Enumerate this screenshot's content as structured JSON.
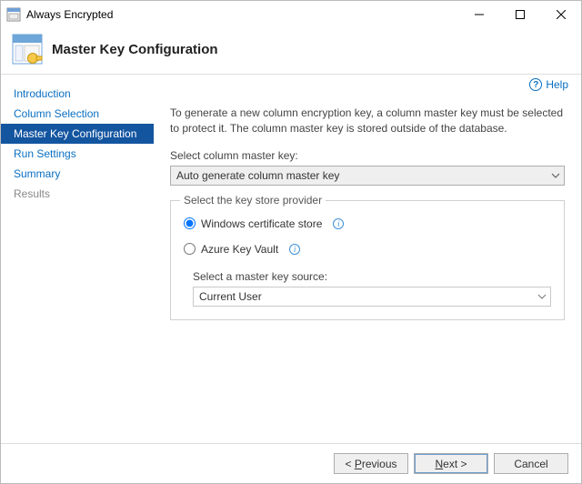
{
  "window": {
    "title": "Always Encrypted"
  },
  "header": {
    "title": "Master Key Configuration"
  },
  "sidebar": {
    "items": [
      {
        "label": "Introduction",
        "state": "link"
      },
      {
        "label": "Column Selection",
        "state": "link"
      },
      {
        "label": "Master Key Configuration",
        "state": "active"
      },
      {
        "label": "Run Settings",
        "state": "link"
      },
      {
        "label": "Summary",
        "state": "link"
      },
      {
        "label": "Results",
        "state": "disabled"
      }
    ]
  },
  "main": {
    "help_label": "Help",
    "intro_text": "To generate a new column encryption key, a column master key must be selected to protect it.  The column master key is stored outside of the database.",
    "select_cmk_label": "Select column master key:",
    "select_cmk_value": "Auto generate column master key",
    "fieldset_legend": "Select the key store provider",
    "radio_windows_label": "Windows certificate store",
    "radio_azure_label": "Azure Key Vault",
    "source_label": "Select a master key source:",
    "source_value": "Current User"
  },
  "footer": {
    "previous": "Previous",
    "next": "Next",
    "cancel": "Cancel"
  }
}
